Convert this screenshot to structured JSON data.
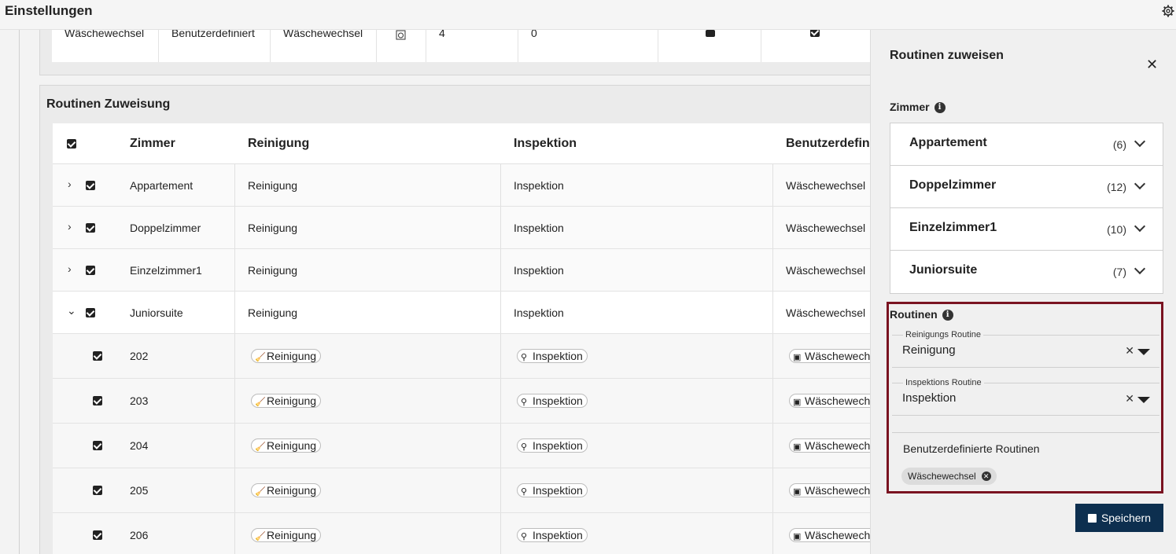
{
  "header": {
    "title": "Einstellungen",
    "settings_icon": "gear-icon"
  },
  "routine_row": {
    "name": "Wäschewechsel",
    "type": "Benutzerdefiniert",
    "label": "Wäschewechsel",
    "icon": "laundry-icon",
    "value1": "4",
    "value2": "0"
  },
  "zuweisung": {
    "heading": "Routinen Zuweisung",
    "columns": {
      "zimmer": "Zimmer",
      "reinigung": "Reinigung",
      "inspektion": "Inspektion",
      "benutzer": "Benutzerdefinie"
    },
    "groups": [
      {
        "name": "Appartement",
        "reinigung": "Reinigung",
        "inspektion": "Inspektion",
        "benutzer": "Wäschewechsel",
        "expanded": false
      },
      {
        "name": "Doppelzimmer",
        "reinigung": "Reinigung",
        "inspektion": "Inspektion",
        "benutzer": "Wäschewechsel",
        "expanded": false
      },
      {
        "name": "Einzelzimmer1",
        "reinigung": "Reinigung",
        "inspektion": "Inspektion",
        "benutzer": "Wäschewechsel",
        "expanded": false
      },
      {
        "name": "Juniorsuite",
        "reinigung": "Reinigung",
        "inspektion": "Inspektion",
        "benutzer": "Wäschewechsel",
        "expanded": true
      }
    ],
    "rooms": [
      {
        "number": "202",
        "reinigung": "Reinigung",
        "inspektion": "Inspektion",
        "benutzer": "Wäschewech"
      },
      {
        "number": "203",
        "reinigung": "Reinigung",
        "inspektion": "Inspektion",
        "benutzer": "Wäschewech"
      },
      {
        "number": "204",
        "reinigung": "Reinigung",
        "inspektion": "Inspektion",
        "benutzer": "Wäschewech"
      },
      {
        "number": "205",
        "reinigung": "Reinigung",
        "inspektion": "Inspektion",
        "benutzer": "Wäschewech"
      },
      {
        "number": "206",
        "reinigung": "Reinigung",
        "inspektion": "Inspektion",
        "benutzer": "Wäschewech"
      }
    ]
  },
  "panel": {
    "title": "Routinen zuweisen",
    "close_icon": "close-icon",
    "zimmer_label": "Zimmer",
    "room_types": [
      {
        "name": "Appartement",
        "count": "(6)"
      },
      {
        "name": "Doppelzimmer",
        "count": "(12)"
      },
      {
        "name": "Einzelzimmer1",
        "count": "(10)"
      },
      {
        "name": "Juniorsuite",
        "count": "(7)"
      }
    ],
    "routinen_label": "Routinen",
    "reinigung_field": {
      "legend": "Reinigungs Routine",
      "value": "Reinigung"
    },
    "inspektion_field": {
      "legend": "Inspektions Routine",
      "value": "Inspektion"
    },
    "custom_label": "Benutzerdefinierte Routinen",
    "custom_tags": [
      "Wäschewechsel"
    ],
    "save_label": "Speichern",
    "accent_color": "#7a1321",
    "button_color": "#0d2f4f"
  }
}
